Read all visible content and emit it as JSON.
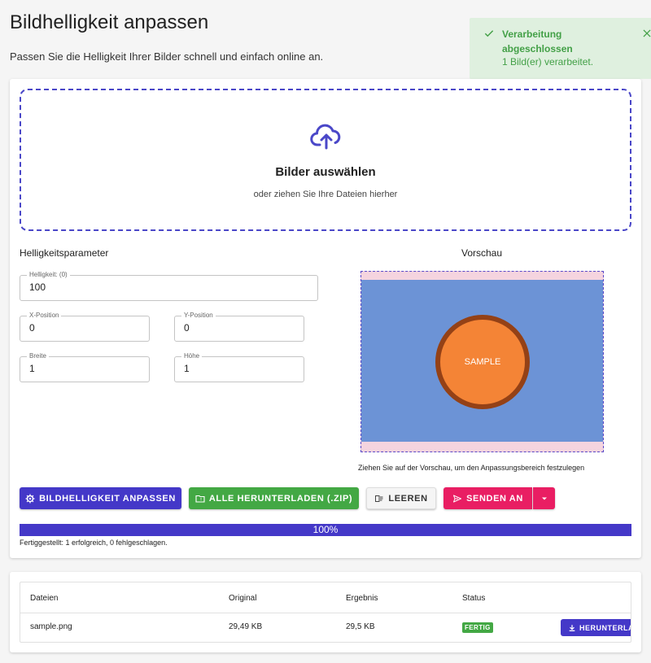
{
  "page": {
    "title": "Bildhelligkeit anpassen",
    "subtitle": "Passen Sie die Helligkeit Ihrer Bilder schnell und einfach online an."
  },
  "toast": {
    "title": "Verarbeitung abgeschlossen",
    "message": "1 Bild(er) verarbeitet.",
    "check_icon": "check-icon",
    "close_icon": "close-icon",
    "color": "#43a047"
  },
  "dropzone": {
    "title": "Bilder auswählen",
    "subtitle": "oder ziehen Sie Ihre Dateien hierher",
    "icon": "cloud-upload-icon"
  },
  "params": {
    "heading": "Helligkeitsparameter",
    "brightness": {
      "label": "Helligkeit: (0)",
      "value": "100"
    },
    "x": {
      "label": "X-Position",
      "value": "0"
    },
    "y": {
      "label": "Y-Position",
      "value": "0"
    },
    "width": {
      "label": "Breite",
      "value": "1"
    },
    "height": {
      "label": "Höhe",
      "value": "1"
    }
  },
  "preview": {
    "heading": "Vorschau",
    "sample_text": "SAMPLE",
    "hint": "Ziehen Sie auf der Vorschau, um den Anpassungsbereich festzulegen"
  },
  "actions": {
    "adjust": "BILDHELLIGKEIT ANPASSEN",
    "download_all": "ALLE HERUNTERLADEN (.ZIP)",
    "clear": "LEEREN",
    "send": "SENDEN AN"
  },
  "progress": {
    "percent": 100,
    "label": "100%",
    "status": "Fertiggestellt: 1 erfolgreich, 0 fehlgeschlagen."
  },
  "table": {
    "headers": [
      "Dateien",
      "Original",
      "Ergebnis",
      "Status"
    ],
    "rows": [
      {
        "file": "sample.png",
        "original": "29,49 KB",
        "result": "29,5 KB",
        "status": "FERTIG",
        "action": "HERUNTERLADEN"
      }
    ]
  },
  "colors": {
    "primary": "#4438c8",
    "success": "#43a844",
    "pink": "#e91e63"
  }
}
